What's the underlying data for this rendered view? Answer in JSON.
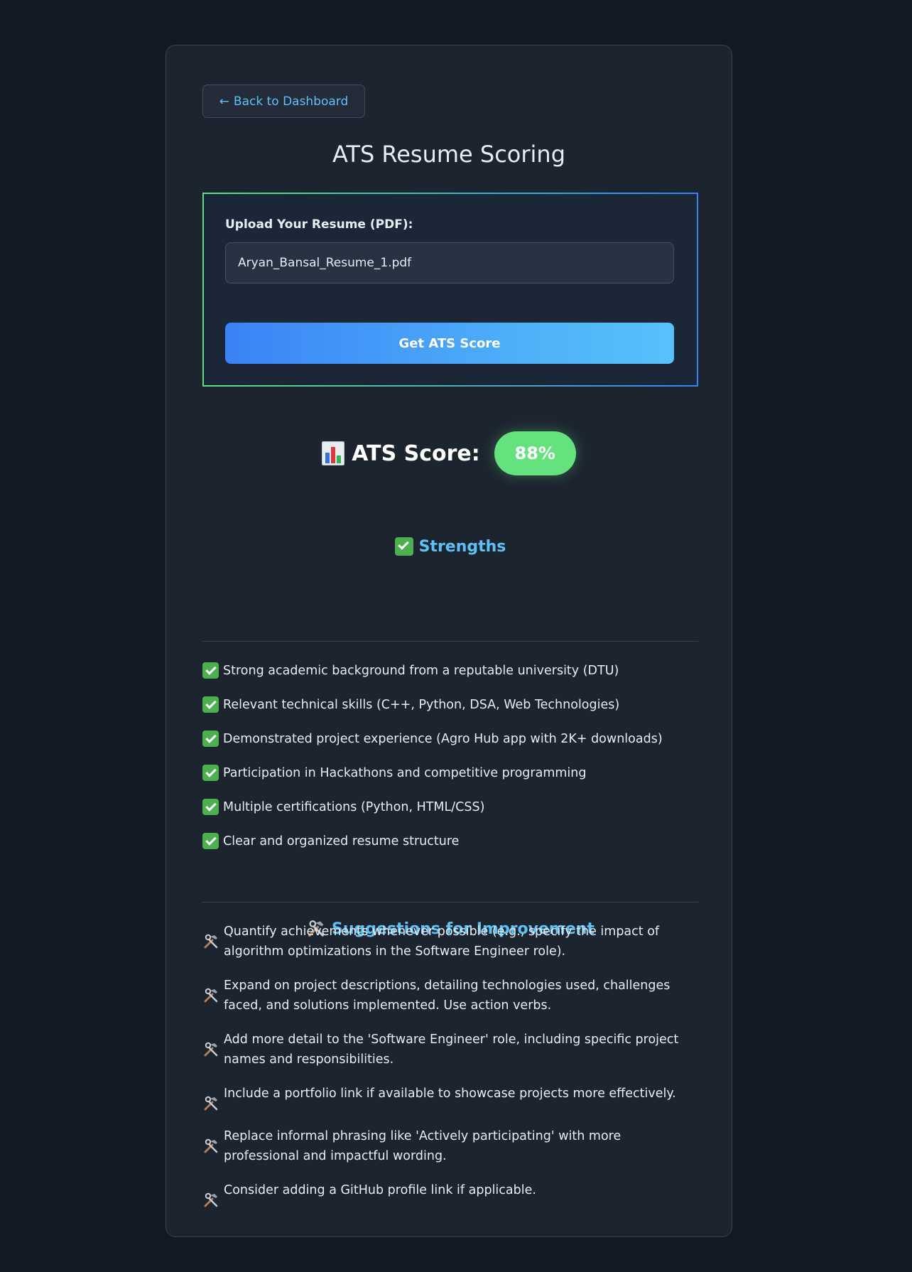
{
  "back_button": {
    "arrow": "←",
    "label": "Back to Dashboard"
  },
  "page_title": "ATS Resume Scoring",
  "upload": {
    "label": "Upload Your Resume (PDF):",
    "file_name": "Aryan_Bansal_Resume_1.pdf",
    "submit_label": "Get ATS Score"
  },
  "score": {
    "icon": "bar-chart-icon",
    "label": "ATS Score:",
    "value": "88%"
  },
  "strengths": {
    "icon": "check-mark-icon",
    "title": "Strengths",
    "items": [
      "Strong academic background from a reputable university (DTU)",
      "Relevant technical skills (C++, Python, DSA, Web Technologies)",
      "Demonstrated project experience (Agro Hub app with 2K+ downloads)",
      "Participation in Hackathons and competitive programming",
      "Multiple certifications (Python, HTML/CSS)",
      "Clear and organized resume structure"
    ]
  },
  "suggestions": {
    "icon": "hammer-wrench-icon",
    "title": "Suggestions for Improvement",
    "items": [
      "Quantify achievements whenever possible (e.g., specify the impact of algorithm optimizations in the Software Engineer role).",
      "Expand on project descriptions, detailing technologies used, challenges faced, and solutions implemented. Use action verbs.",
      "Add more detail to the 'Software Engineer' role, including specific project names and responsibilities.",
      "Include a portfolio link if available to showcase projects more effectively.",
      "Replace informal phrasing like 'Actively participating' with more professional and impactful wording.",
      "Consider adding a GitHub profile link if applicable."
    ]
  },
  "colors": {
    "background": "#111922",
    "card": "#1c2430",
    "accent_blue": "#5fc0f5",
    "score_green": "#63e27e",
    "button_gradient_start": "#3b82f6",
    "button_gradient_end": "#56c1fa"
  }
}
